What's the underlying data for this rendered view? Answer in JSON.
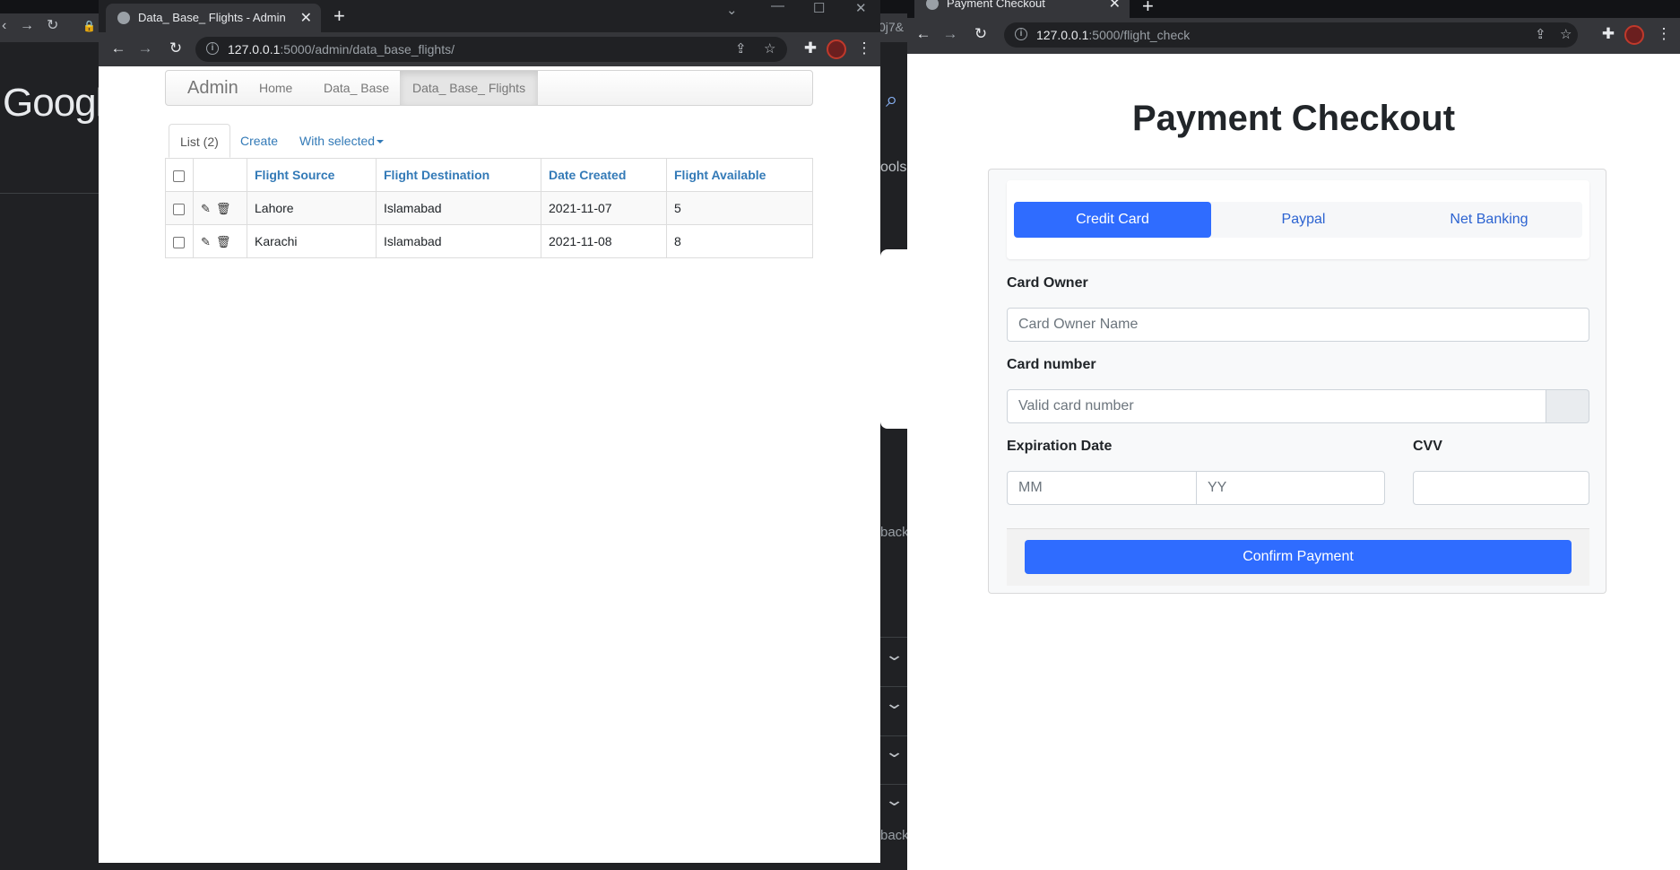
{
  "background_window": {
    "google_logo": "Google",
    "fragment_url": "0j7&",
    "fragment_tools": "ools",
    "fragment_back_1": "back",
    "fragment_back_2": "back"
  },
  "admin_window": {
    "tab_title": "Data_ Base_ Flights - Admin",
    "url_host": "127.0.0.1",
    "url_rest": ":5000/admin/data_base_flights/",
    "navbar": {
      "brand": "Admin",
      "links": [
        "Home",
        "Data_ Base",
        "Data_ Base_ Flights"
      ],
      "active_link": "Data_ Base_ Flights"
    },
    "subtabs": {
      "list": "List (2)",
      "create": "Create",
      "with_selected": "With selected"
    },
    "table": {
      "columns": [
        "Flight Source",
        "Flight Destination",
        "Date Created",
        "Flight Available"
      ],
      "rows": [
        [
          "Lahore",
          "Islamabad",
          "2021-11-07",
          "5"
        ],
        [
          "Karachi",
          "Islamabad",
          "2021-11-08",
          "8"
        ]
      ]
    }
  },
  "payment_window": {
    "tab_title": "Payment Checkout",
    "url_host": "127.0.0.1",
    "url_rest": ":5000/flight_check",
    "title": "Payment Checkout",
    "methods": [
      "Credit Card",
      "Paypal",
      "Net Banking"
    ],
    "active_method": "Credit Card",
    "form": {
      "card_owner_label": "Card Owner",
      "card_owner_placeholder": "Card Owner Name",
      "card_number_label": "Card number",
      "card_number_placeholder": "Valid card number",
      "expiration_label": "Expiration Date",
      "mm_placeholder": "MM",
      "yy_placeholder": "YY",
      "cvv_label": "CVV"
    },
    "confirm_label": "Confirm Payment"
  },
  "colors": {
    "primary_button": "#2f6cff",
    "link_blue": "#337ab7",
    "chrome_dark": "#202124",
    "chrome_toolbar": "#35363a"
  }
}
